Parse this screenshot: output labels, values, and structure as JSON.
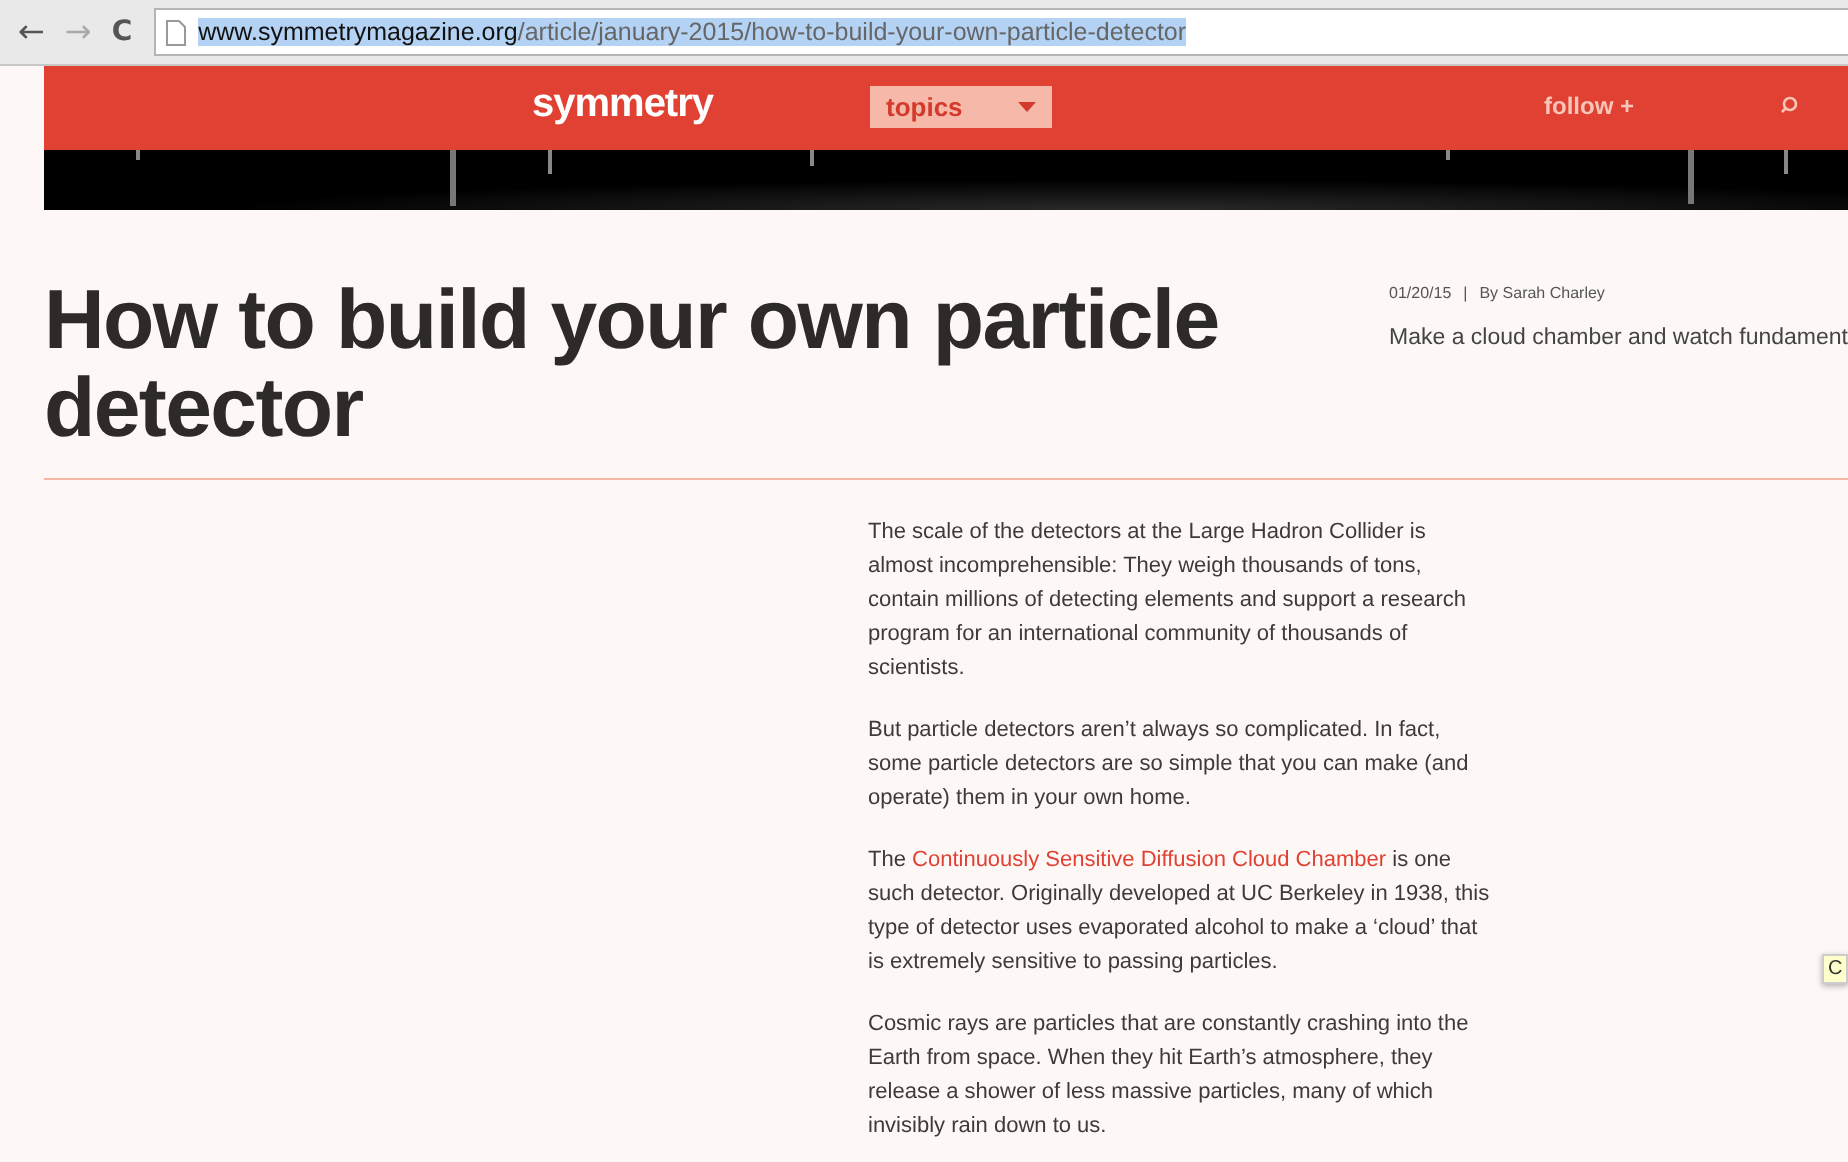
{
  "browser": {
    "url_host": "www.symmetrymagazine.org",
    "url_path": "/article/january-2015/how-to-build-your-own-particle-detector",
    "back": "←",
    "forward": "→",
    "reload": "C"
  },
  "header": {
    "logo": "symmetry",
    "topics": "topics",
    "follow": "follow +"
  },
  "article": {
    "title": "How to build your own particle detector",
    "date": "01/20/15",
    "separator": "|",
    "byline": "By Sarah Charley",
    "summary": "Make a cloud chamber and watch fundament",
    "paragraphs": [
      {
        "parts": [
          {
            "kind": "plain",
            "text": "The scale of the detectors at the Large Hadron Collider is almost incomprehensible: They weigh thousands of tons, contain millions of detecting elements and support a research program for an international community of thousands of scientists."
          }
        ]
      },
      {
        "parts": [
          {
            "kind": "plain",
            "text": "But particle detectors aren’t always so complicated. In fact, some particle detectors are so simple that you can make (and operate) them in your own home."
          }
        ]
      },
      {
        "parts": [
          {
            "kind": "plain",
            "text": "The "
          },
          {
            "kind": "link",
            "text": "Continuously Sensitive Diffusion Cloud Chamber"
          },
          {
            "kind": "plain",
            "text": " is one such detector. Originally developed at UC Berkeley in 1938, this type of detector uses evaporated alcohol to make a ‘cloud’ that is extremely sensitive to passing particles."
          }
        ]
      },
      {
        "parts": [
          {
            "kind": "plain",
            "text": "Cosmic rays are particles that are constantly crashing into the Earth from space. When they hit Earth’s atmosphere, they release a shower of less massive particles, many of which invisibly rain down to us."
          }
        ]
      }
    ]
  },
  "tooltip": "C"
}
